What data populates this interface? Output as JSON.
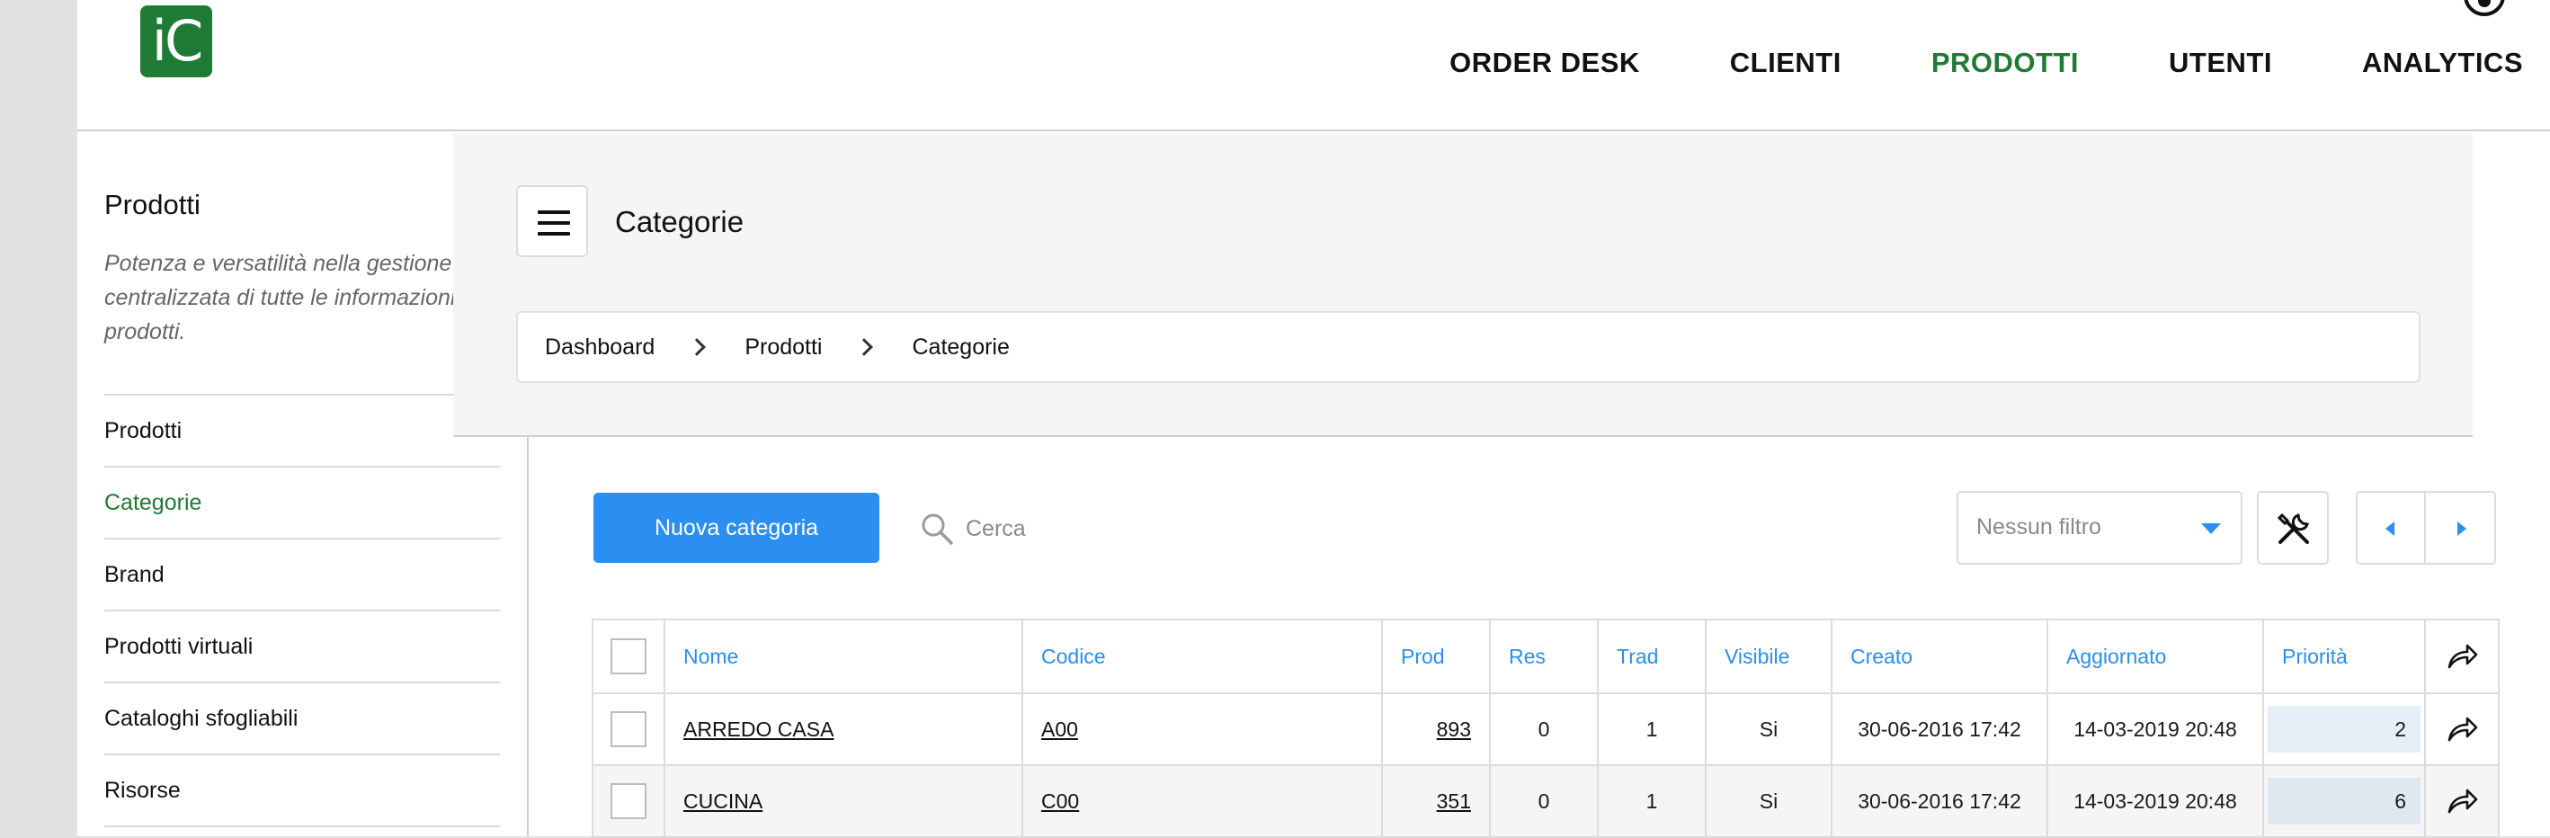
{
  "header": {
    "logo_text": "iC",
    "nav": [
      "ORDER DESK",
      "CLIENTI",
      "PRODOTTI",
      "UTENTI",
      "ANALYTICS"
    ],
    "active_nav": "PRODOTTI",
    "accent_color": "#1e7b34"
  },
  "sidebar": {
    "title": "Prodotti",
    "description": "Potenza e versatilità nella gestione centralizzata di tutte le informazioni sui prodotti.",
    "items": [
      {
        "label": "Prodotti"
      },
      {
        "label": "Categorie"
      },
      {
        "label": "Brand"
      },
      {
        "label": "Prodotti virtuali"
      },
      {
        "label": "Cataloghi sfogliabili"
      },
      {
        "label": "Risorse"
      }
    ],
    "active_item": "Categorie"
  },
  "main": {
    "page_title": "Categorie",
    "breadcrumb": [
      "Dashboard",
      "Prodotti",
      "Categorie"
    ]
  },
  "toolbar": {
    "new_button_label": "Nuova categoria",
    "search_placeholder": "Cerca",
    "filter_label": "Nessun filtro",
    "primary_color": "#2a8ff0"
  },
  "table": {
    "columns": [
      "Nome",
      "Codice",
      "Prod",
      "Res",
      "Trad",
      "Visibile",
      "Creato",
      "Aggiornato",
      "Priorità"
    ],
    "rows": [
      {
        "nome": "ARREDO CASA",
        "codice": "A00",
        "prod": "893",
        "res": "0",
        "trad": "1",
        "visibile": "Si",
        "creato": "30-06-2016 17:42",
        "aggiornato": "14-03-2019 20:48",
        "priorita": "2"
      },
      {
        "nome": "CUCINA",
        "codice": "C00",
        "prod": "351",
        "res": "0",
        "trad": "1",
        "visibile": "Si",
        "creato": "30-06-2016 17:42",
        "aggiornato": "14-03-2019 20:48",
        "priorita": "6"
      }
    ]
  },
  "icons": [
    "menu-icon",
    "chevron-right-icon",
    "search-icon",
    "caret-down-icon",
    "tools-icon",
    "prev-icon",
    "next-icon",
    "share-icon",
    "avatar-icon"
  ]
}
